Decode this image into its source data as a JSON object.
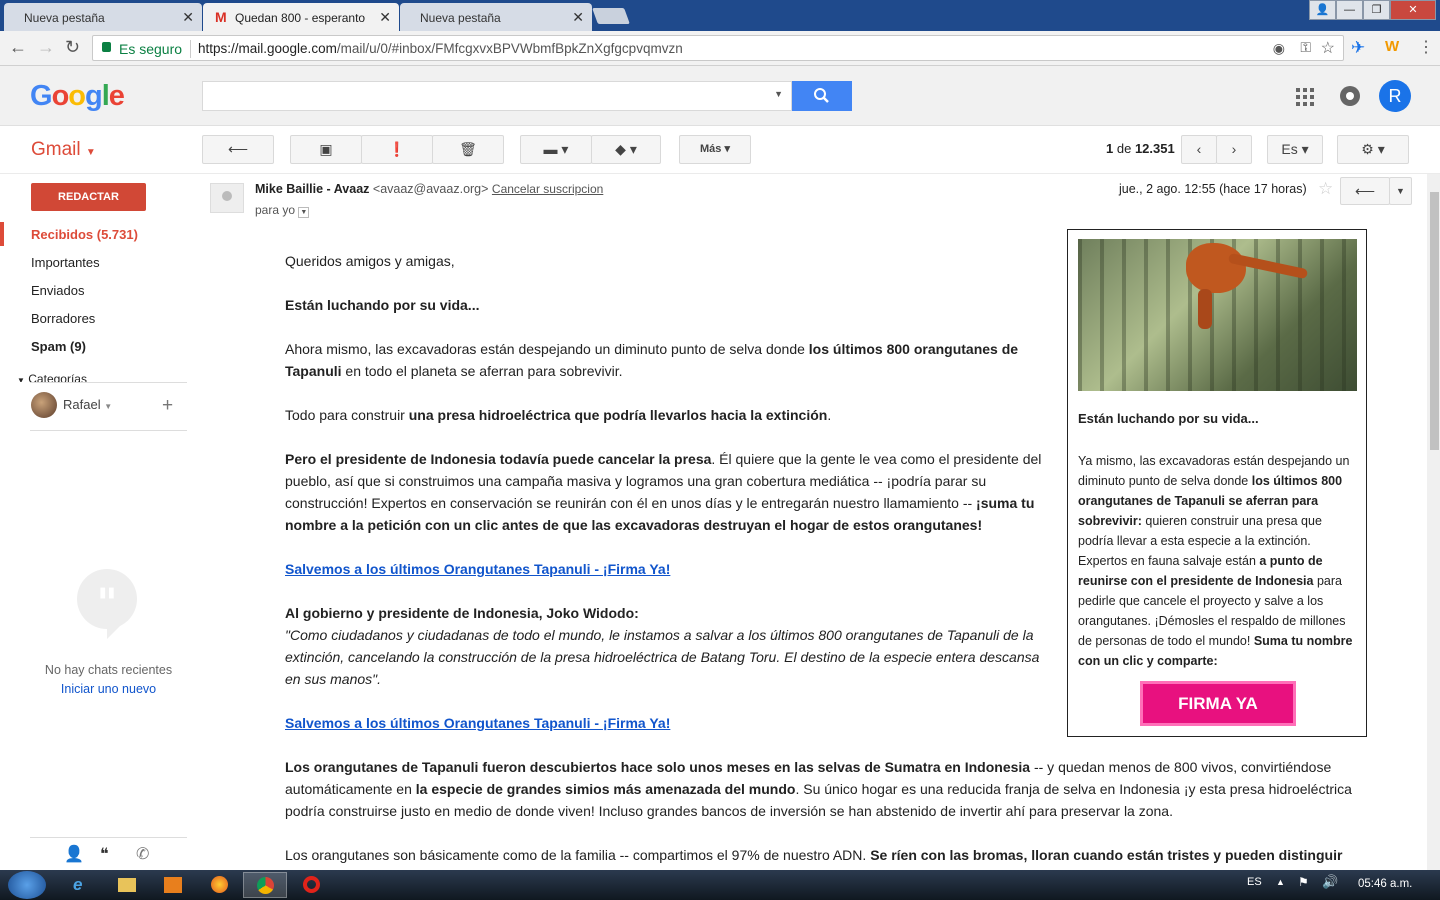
{
  "browser": {
    "tabs": [
      {
        "title": "Nueva pestaña"
      },
      {
        "title": "Quedan 800 - esperanto"
      },
      {
        "title": "Nueva pestaña"
      }
    ],
    "security_label": "Es seguro",
    "url_host": "https://mail.google.com",
    "url_path": "/mail/u/0/#inbox/FMfcgxvxBPVWbmfBpkZnXgfgcpvqmvzn"
  },
  "header": {
    "logo": "Google",
    "search_placeholder": "",
    "avatar_letter": "R"
  },
  "gmail": {
    "app_name": "Gmail",
    "more_label": "Más",
    "pager": {
      "range": "1",
      "of_label": "de",
      "total": "12.351"
    },
    "lang_label": "Es"
  },
  "sidebar": {
    "compose": "REDACTAR",
    "items": [
      {
        "label": "Recibidos (5.731)"
      },
      {
        "label": "Importantes"
      },
      {
        "label": "Enviados"
      },
      {
        "label": "Borradores"
      },
      {
        "label": "Spam (9)"
      }
    ],
    "categories": "Categorías",
    "user": "Rafael",
    "no_chats": "No hay chats recientes",
    "start_new": "Iniciar uno nuevo"
  },
  "message": {
    "sender_name": "Mike Baillie - Avaaz",
    "sender_email": "<avaaz@avaaz.org>",
    "unsubscribe": "Cancelar suscripcion",
    "to": "para yo",
    "date": "jue., 2 ago. 12:55 (hace 17 horas)",
    "greeting": "Queridos amigos y amigas,",
    "headline": "Están luchando por su vida...",
    "p1a": "Ahora mismo, las excavadoras están despejando un diminuto punto de selva donde ",
    "p1b": "los últimos 800 orangutanes de Tapanuli",
    "p1c": " en todo el planeta se aferran para sobrevivir.",
    "p2a": "Todo para construir ",
    "p2b": "una presa hidroeléctrica que podría llevarlos hacia la extinción",
    "p2c": ".",
    "p3a": "Pero el presidente de Indonesia todavía puede cancelar la presa",
    "p3b": ". Él quiere que la gente le vea como el presidente del pueblo, así que si construimos una campaña masiva y logramos una gran cobertura mediática -- ¡podría parar su construcción! Expertos en conservación se reunirán con él en unos días y le entregarán nuestro llamamiento -- ",
    "p3c": "¡suma tu nombre a la petición con un clic antes de que las excavadoras destruyan el hogar de estos orangutanes!",
    "link1": "Salvemos a los últimos Orangutanes Tapanuli - ¡Firma Ya!",
    "petition_title": "Al gobierno y presidente de Indonesia, Joko Widodo:",
    "petition_text": "\"Como ciudadanos y ciudadanas de todo el mundo, le instamos a salvar a los últimos 800 orangutanes de Tapanuli de la extinción, cancelando la construcción de la presa hidroeléctrica de Batang Toru. El destino de la especie entera descansa en sus manos\".",
    "link2": "Salvemos a los últimos Orangutanes Tapanuli - ¡Firma Ya!",
    "p4a": "Los orangutanes de Tapanuli fueron descubiertos hace solo unos meses en las selvas de Sumatra en Indonesia",
    "p4b": " -- y quedan menos de 800 vivos, convirtiéndose automáticamente en ",
    "p4c": "la especie de grandes simios más amenazada del mundo",
    "p4d": ". Su único hogar es una reducida franja de selva en Indonesia ¡y esta presa hidroeléctrica podría construirse justo en medio de donde viven! Incluso grandes bancos de inversión se han abstenido de invertir ahí para preservar la zona.",
    "p5a": "Los orangutanes son básicamente como de la familia -- compartimos el 97% de nuestro ADN. ",
    "p5b": "Se ríen con las bromas, lloran cuando están tristes y pueden distinguir"
  },
  "promo": {
    "title": "Están luchando por su vida...",
    "t1": "Ya mismo, las excavadoras están despejando un diminuto punto de selva donde ",
    "t2": "los últimos 800 orangutanes de Tapanuli se aferran para sobrevivir:",
    "t3": " quieren construir una presa que podría llevar a esta especie a la extinción. Expertos en fauna salvaje están ",
    "t4": "a punto de reunirse con el presidente de Indonesia",
    "t5": " para pedirle que cancele el proyecto y salve a los orangutanes. ¡Démosles el respaldo de millones de personas de todo el mundo! ",
    "t6": "Suma tu nombre con un clic y comparte:",
    "button": "FIRMA YA"
  },
  "taskbar": {
    "lang": "ES",
    "time": "05:46 a.m."
  }
}
